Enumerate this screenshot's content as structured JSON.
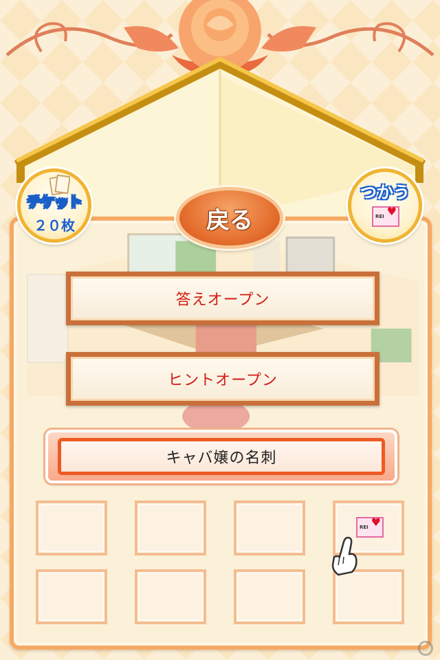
{
  "tickets": {
    "label": "チケット",
    "count": "２０枚"
  },
  "use_button": {
    "label": "つかう",
    "card_text": "REI"
  },
  "back_button": {
    "label": "戻る"
  },
  "options": {
    "answer_open": "答えオープン",
    "hint_open": "ヒントオープン"
  },
  "selected_item": {
    "name": "キャバ嬢の名刺"
  },
  "inventory": {
    "slots": [
      {
        "item": ""
      },
      {
        "item": ""
      },
      {
        "item": ""
      },
      {
        "item": "business-card",
        "card_text": "REI"
      },
      {
        "item": ""
      },
      {
        "item": ""
      },
      {
        "item": ""
      },
      {
        "item": ""
      }
    ]
  },
  "colors": {
    "accent": "#e46c2c",
    "option_text": "#d11c14",
    "badge_blue": "#1a5fc8",
    "panel_border": "#f6a964"
  }
}
